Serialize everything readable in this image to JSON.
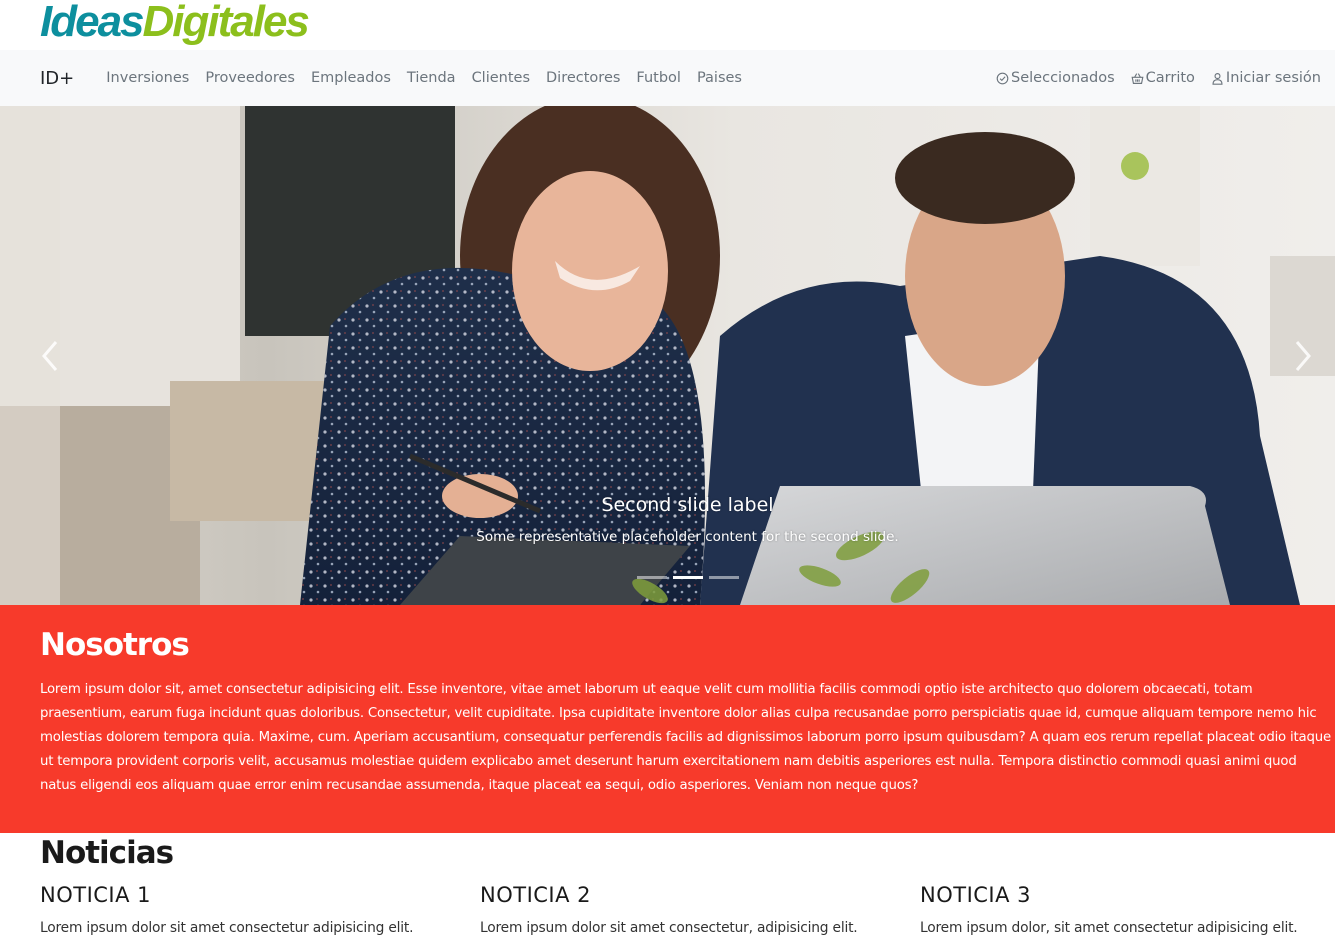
{
  "logo": {
    "word1": "Ideas",
    "word2": "Digitales"
  },
  "navbar": {
    "brand": "ID+",
    "links": [
      "Inversiones",
      "Proveedores",
      "Empleados",
      "Tienda",
      "Clientes",
      "Directores",
      "Futbol",
      "Paises"
    ],
    "right": {
      "selected": {
        "label": "Seleccionados",
        "icon": "check-circle-icon"
      },
      "cart": {
        "label": "Carrito",
        "icon": "basket-icon"
      },
      "login": {
        "label": "Iniciar sesión",
        "icon": "person-icon"
      }
    }
  },
  "carousel": {
    "caption_title": "Second slide label",
    "caption_text": "Some representative placeholder content for the second slide.",
    "slide_count": 3,
    "active_index": 1
  },
  "about": {
    "title": "Nosotros",
    "text": "Lorem ipsum dolor sit, amet consectetur adipisicing elit. Esse inventore, vitae amet laborum ut eaque velit cum mollitia facilis commodi optio iste architecto quo dolorem obcaecati, totam praesentium, earum fuga incidunt quas doloribus. Consectetur, velit cupiditate. Ipsa cupiditate inventore dolor alias culpa recusandae porro perspiciatis quae id, cumque aliquam tempore nemo hic molestias dolorem tempora quia. Maxime, cum. Aperiam accusantium, consequatur perferendis facilis ad dignissimos laborum porro ipsum quibusdam? A quam eos rerum repellat placeat odio itaque ut tempora provident corporis velit, accusamus molestiae quidem explicabo amet deserunt harum exercitationem nam debitis asperiores est nulla. Tempora distinctio commodi quasi animi quod natus eligendi eos aliquam quae error enim recusandae assumenda, itaque placeat ea sequi, odio asperiores. Veniam non neque quos?"
  },
  "news": {
    "title": "Noticias",
    "items": [
      {
        "title": "NOTICIA 1",
        "text": "Lorem ipsum dolor sit amet consectetur adipisicing elit."
      },
      {
        "title": "NOTICIA 2",
        "text": "Lorem ipsum dolor sit amet consectetur, adipisicing elit."
      },
      {
        "title": "NOTICIA 3",
        "text": "Lorem ipsum dolor, sit amet consectetur adipisicing elit."
      }
    ]
  },
  "colors": {
    "accent": "#f73a2b",
    "logo_teal": "#0d8f9e",
    "logo_green": "#8cbf1c",
    "navbar_bg": "#f8f9fa"
  }
}
